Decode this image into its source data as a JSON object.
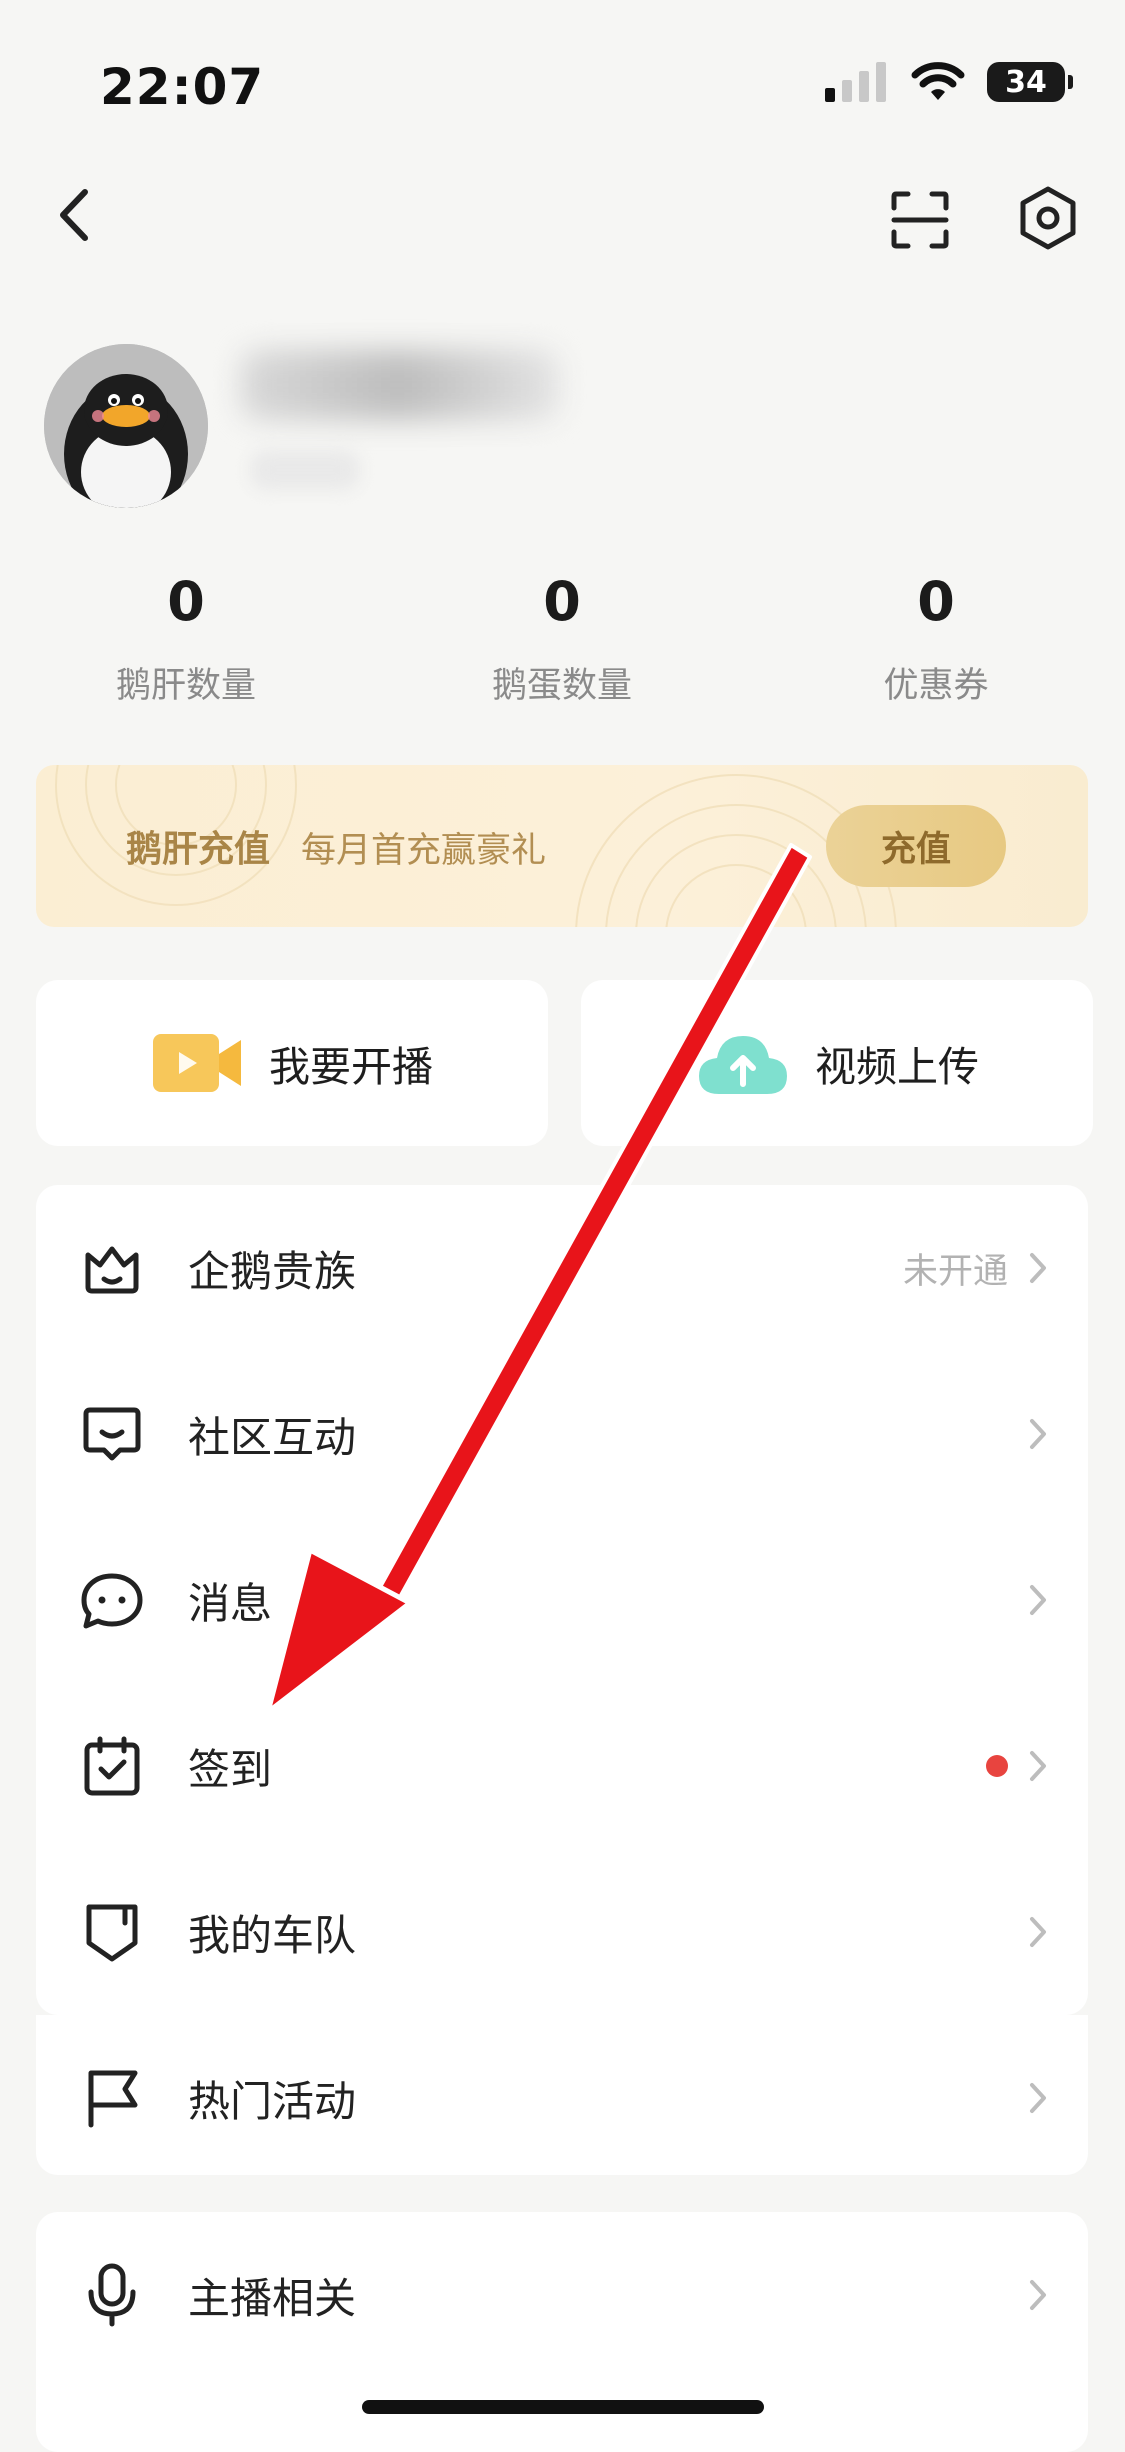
{
  "status_bar": {
    "time": "22:07",
    "battery": "34"
  },
  "nav": {
    "back": "back-icon",
    "scan": "scan-icon",
    "settings": "settings-icon"
  },
  "stats": [
    {
      "value": "0",
      "label": "鹅肝数量"
    },
    {
      "value": "0",
      "label": "鹅蛋数量"
    },
    {
      "value": "0",
      "label": "优惠券"
    }
  ],
  "banner": {
    "title": "鹅肝充值",
    "subtitle": "每月首充赢豪礼",
    "button": "充值"
  },
  "actions": {
    "live": "我要开播",
    "upload": "视频上传"
  },
  "menu": [
    {
      "label": "企鹅贵族",
      "status": "未开通"
    },
    {
      "label": "社区互动"
    },
    {
      "label": "消息"
    },
    {
      "label": "签到",
      "has_dot": true
    },
    {
      "label": "我的车队"
    },
    {
      "label": "热门活动"
    },
    {
      "label": "主播相关"
    }
  ],
  "colors": {
    "accent": "#e7c982",
    "red_dot": "#e8443f",
    "background": "#f6f6f4",
    "arrow": "#e8141a"
  }
}
